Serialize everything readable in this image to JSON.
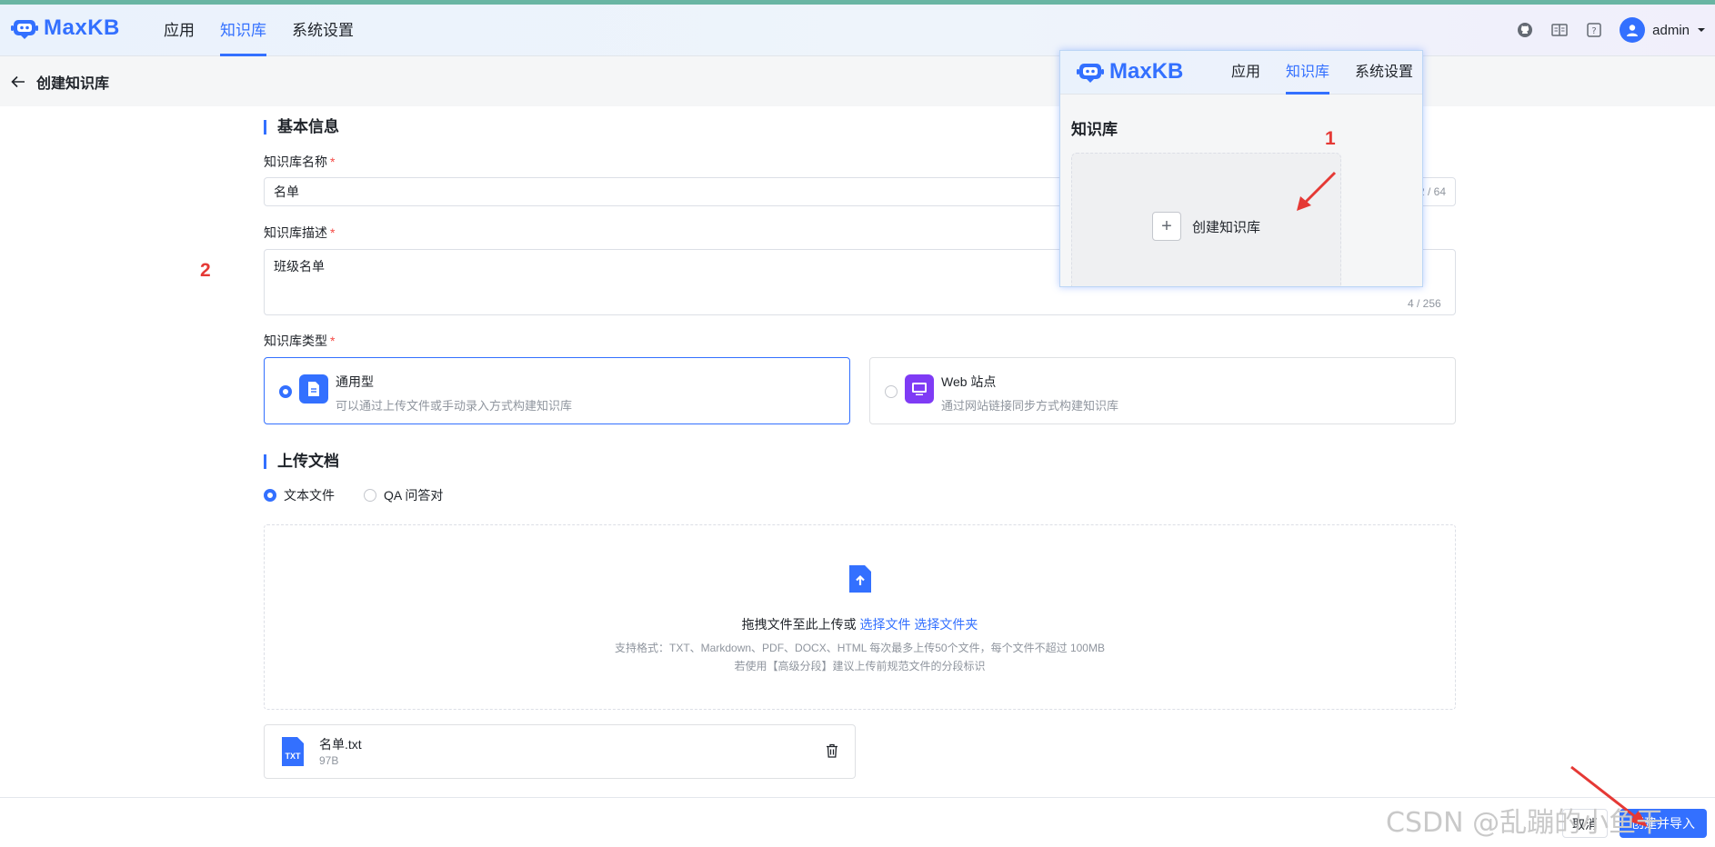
{
  "header": {
    "brand": "MaxKB",
    "nav": [
      {
        "label": "应用",
        "active": false
      },
      {
        "label": "知识库",
        "active": true
      },
      {
        "label": "系统设置",
        "active": false
      }
    ],
    "user": "admin",
    "icons": [
      "github-icon",
      "book-icon",
      "help-icon",
      "avatar",
      "chevron-down-icon"
    ]
  },
  "subheader": {
    "title": "创建知识库",
    "back_icon": "arrow-left-icon"
  },
  "basic": {
    "section_title": "基本信息",
    "name_label": "知识库名称",
    "name_value": "名单",
    "name_counter": "2 / 64",
    "desc_label": "知识库描述",
    "desc_value": "班级名单",
    "desc_counter": "4 / 256",
    "type_label": "知识库类型",
    "required_mark": "*",
    "types": [
      {
        "title": "通用型",
        "desc": "可以通过上传文件或手动录入方式构建知识库",
        "selected": true,
        "color": "#3370ff"
      },
      {
        "title": "Web 站点",
        "desc": "通过网站链接同步方式构建知识库",
        "selected": false,
        "color": "#7f3bf5"
      }
    ]
  },
  "upload": {
    "section_title": "上传文档",
    "modes": [
      {
        "label": "文本文件",
        "selected": true
      },
      {
        "label": "QA 问答对",
        "selected": false
      }
    ],
    "drop_text": "拖拽文件至此上传或",
    "select_file": "选择文件",
    "select_folder": "选择文件夹",
    "hint1": "支持格式：TXT、Markdown、PDF、DOCX、HTML 每次最多上传50个文件，每个文件不超过 100MB",
    "hint2": "若使用【高级分段】建议上传前规范文件的分段标识",
    "file": {
      "badge": "TXT",
      "name": "名单.txt",
      "size": "97B"
    }
  },
  "footer": {
    "cancel": "取消",
    "submit": "创建并导入"
  },
  "overlay": {
    "brand": "MaxKB",
    "nav": [
      {
        "label": "应用",
        "active": false
      },
      {
        "label": "知识库",
        "active": true
      },
      {
        "label": "系统设置",
        "active": false
      }
    ],
    "title": "知识库",
    "create_label": "创建知识库"
  },
  "annotations": {
    "step1": "1",
    "step2": "2"
  },
  "watermark": "CSDN @乱蹦的小鱼干",
  "colors": {
    "primary": "#3370ff",
    "annotation": "#e53935"
  }
}
